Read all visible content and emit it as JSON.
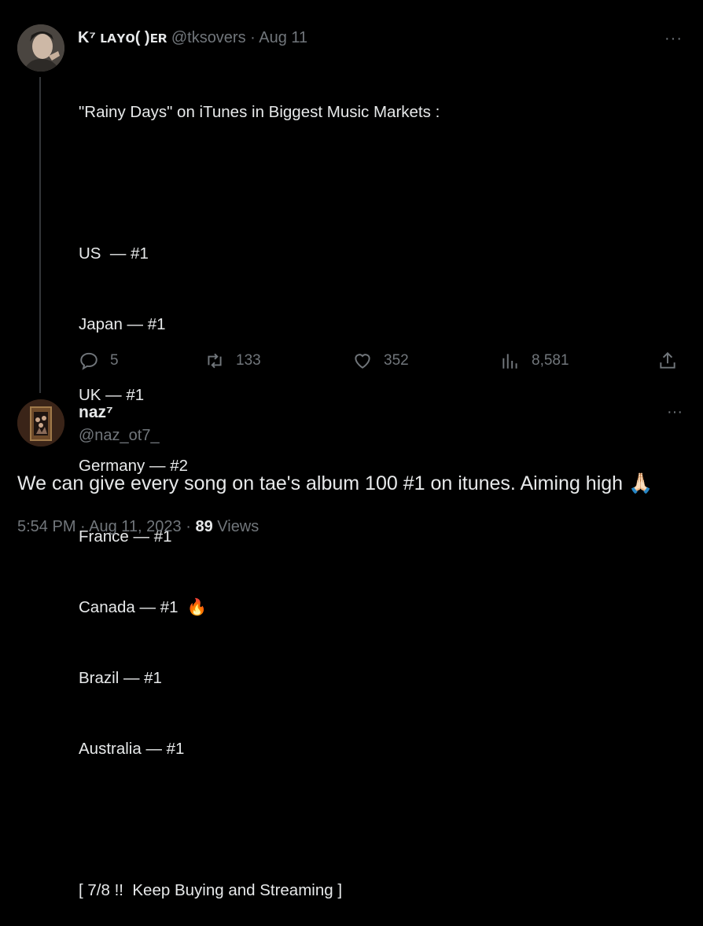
{
  "tweet1": {
    "author_name": "K⁷ ʟᴀʏᴏ(  )ᴇʀ",
    "handle": "@tksovers",
    "separator": " · ",
    "date": "Aug 11",
    "lines": [
      "\"Rainy Days\" on iTunes in Biggest Music Markets :",
      "",
      "US  — #1",
      "Japan — #1",
      "UK — #1",
      "Germany — #2",
      "France — #1",
      "Canada — #1  🔥",
      "Brazil — #1",
      "Australia — #1",
      "",
      "[ 7/8 !!  Keep Buying and Streaming ]"
    ],
    "replies": "5",
    "retweets": "133",
    "likes": "352",
    "views": "8,581",
    "more": "···"
  },
  "tweet2": {
    "author_name": "naz⁷",
    "handle": "@naz_ot7_",
    "text": "We can give every song on tae's album 100 #1 on itunes. Aiming high 🙏🏻",
    "time": "5:54 PM",
    "date": "Aug 11, 2023",
    "views_count": "89",
    "views_label": "Views",
    "sep": " · ",
    "more": "···"
  },
  "colors": {
    "background": "#000000",
    "text": "#e7e9ea",
    "muted": "#71767b",
    "divider": "#333639"
  }
}
